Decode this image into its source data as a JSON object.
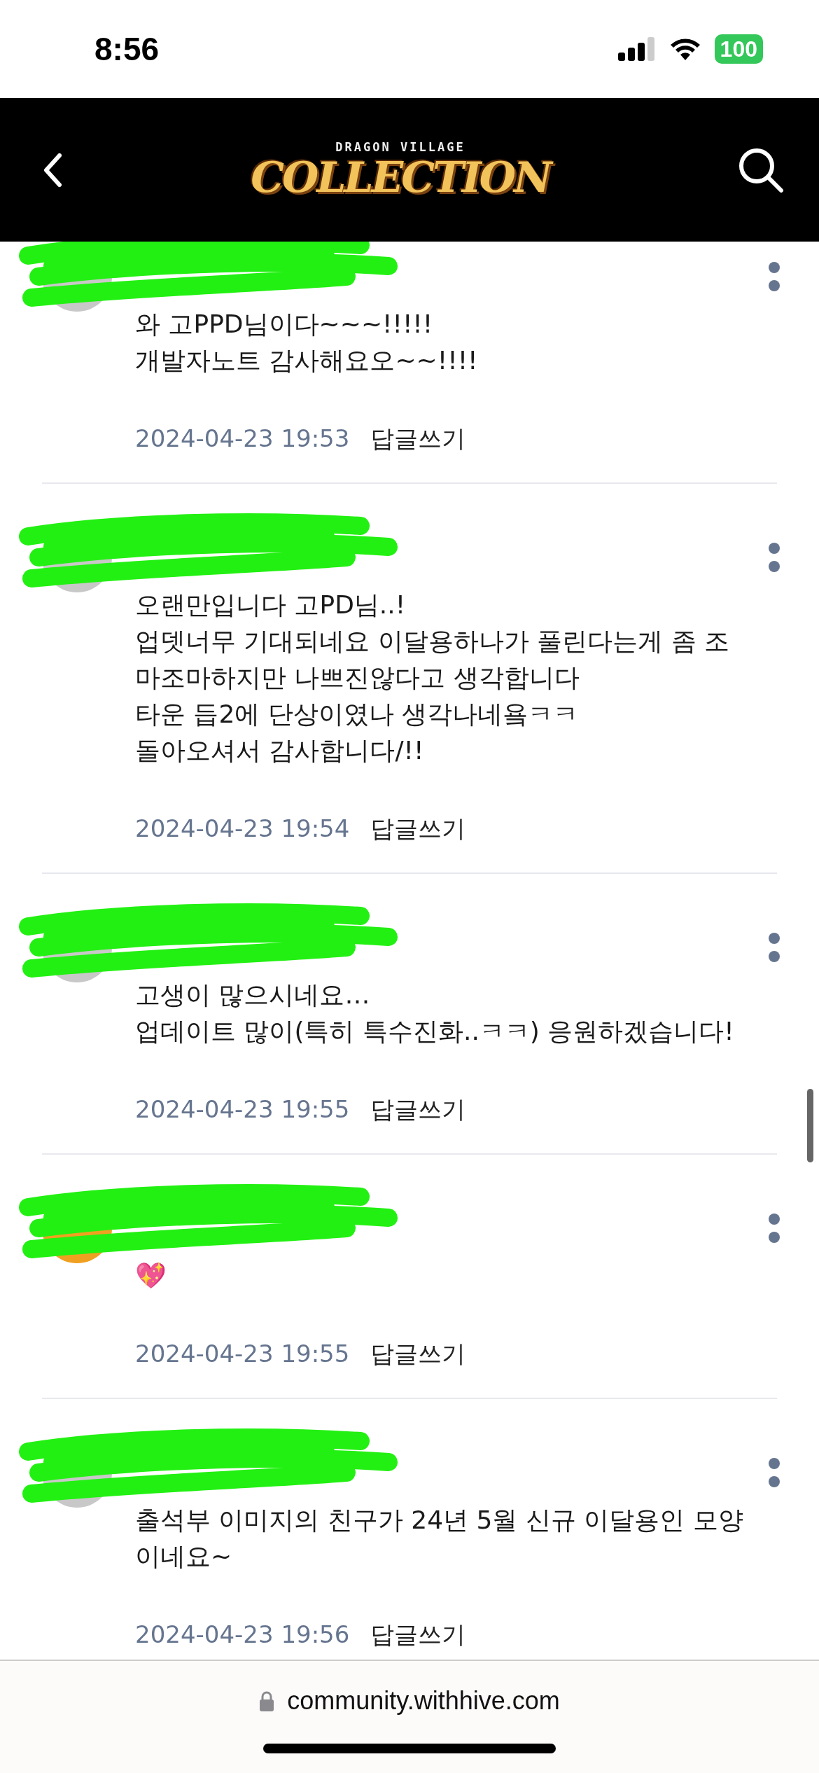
{
  "status_bar": {
    "time": "8:56",
    "battery": "100"
  },
  "header": {
    "logo_top": "DRAGON VILLAGE",
    "logo_main": "COLLECTION"
  },
  "comments": [
    {
      "color": "#c8c8c8",
      "lines": [
        "와 고PPD님이다~~~!!!!!",
        "개발자노트 감사해요오~~!!!!"
      ],
      "date": "2024-04-23 19:53",
      "reply": "답글쓰기"
    },
    {
      "color": "#c8c8c8",
      "lines": [
        "오랜만입니다 고PD님..!",
        "업뎃너무 기대되네요 이달용하나가 풀린다는게 좀 조",
        "마조마하지만 나쁘진않다고 생각합니다",
        "타운 듭2에 단상이였나 생각나네욬ㅋㅋ",
        "돌아오셔서 감사합니다/!!"
      ],
      "date": "2024-04-23 19:54",
      "reply": "답글쓰기"
    },
    {
      "color": "#c8c8c8",
      "lines": [
        "고생이 많으시네요…",
        "업데이트 많이(특히 특수진화..ㅋㅋ) 응원하겠습니다!"
      ],
      "date": "2024-04-23 19:55",
      "reply": "답글쓰기"
    },
    {
      "color": "#f0a020",
      "lines": [
        "💖"
      ],
      "date": "2024-04-23 19:55",
      "reply": "답글쓰기"
    },
    {
      "color": "#c8c8c8",
      "lines": [
        "출석부 이미지의 친구가 24년 5월 신규 이달용인 모양",
        "이네요~"
      ],
      "date": "2024-04-23 19:56",
      "reply": "답글쓰기"
    }
  ],
  "address_bar": {
    "url": "community.withhive.com"
  }
}
